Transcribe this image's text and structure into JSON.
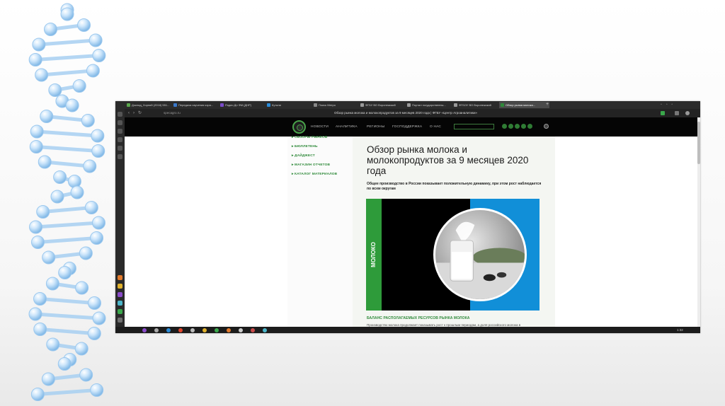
{
  "browser": {
    "tabs": [
      {
        "label": "Доклад_Хорний (2018) 551..."
      },
      {
        "label": "Передача изучения кора..."
      },
      {
        "label": "Радио Дн ФМ (ДНР)"
      },
      {
        "label": "Кутали"
      },
      {
        "label": "Поиск Метро"
      },
      {
        "label": "ФГБУ ВО Воронежский"
      },
      {
        "label": "Портал государственны..."
      },
      {
        "label": "ФГБОУ ВО Воронежский"
      },
      {
        "label": "Обзор рынка молока..."
      }
    ],
    "page_title": "Обзор рынка молока и молокопродуктов за 9 месяцев 2020 года | ФГБУ «Центр Агроаналитики»",
    "url": "specagro.ru",
    "taskbar_time": "1:32"
  },
  "site": {
    "nav": [
      "НОВОСТИ",
      "АНАЛИТИКА",
      "РЕГИОНЫ",
      "ГОСПОДДЕРЖКА",
      "О НАС"
    ],
    "left_menu": [
      "ОБЗОРЫ РЫНКОВ",
      "БЮЛЛЕТЕНЬ",
      "ДАЙДЖЕСТ",
      "МАГАЗИН ОТЧЕТОВ",
      "КАТАЛОГ МАТЕРИАЛОВ"
    ],
    "article_title": "Обзор рынка молока и молокопродуктов за 9 месяцев 2020 года",
    "lead": "Общее производство в России показывает положительную динамику, при этом рост наблюдается по всем округам",
    "hero_label": "МОЛОКО",
    "section_heading": "БАЛАНС РАСПОЛАГАЕМЫХ РЕСУРСОВ РЫНКА МОЛОКА",
    "body_text": "Производство молока продолжает показывать рост к прошлым периодам, а доля российского молока в"
  },
  "colors": {
    "accent_green": "#2f8a3a",
    "hero_blue": "#118fd8",
    "dark_bg": "#050505"
  }
}
